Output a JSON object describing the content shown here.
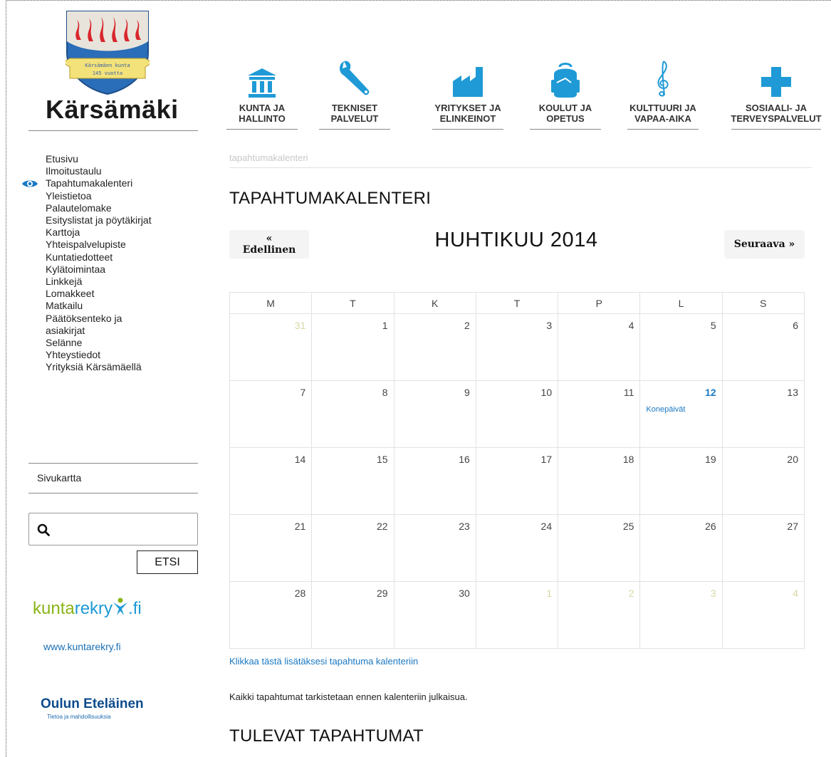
{
  "site": {
    "name": "Kärsämäki",
    "crest_text_1": "Kärsämäen kunta",
    "crest_text_2": "145 vuotta"
  },
  "top_nav": [
    {
      "line1": "KUNTA JA",
      "line2": "HALLINTO",
      "icon": "town-hall-icon"
    },
    {
      "line1": "TEKNISET",
      "line2": "PALVELUT",
      "icon": "wrench-icon"
    },
    {
      "line1": "YRITYKSET JA",
      "line2": "ELINKEINOT",
      "icon": "factory-icon"
    },
    {
      "line1": "KOULUT JA",
      "line2": "OPETUS",
      "icon": "backpack-icon"
    },
    {
      "line1": "KULTTUURI JA",
      "line2": "VAPAA-AIKA",
      "icon": "treble-clef-icon"
    },
    {
      "line1": "SOSIAALI- JA",
      "line2": "TERVEYSPALVELUT",
      "icon": "medical-cross-icon"
    }
  ],
  "side_nav": [
    "Etusivu",
    "Ilmoitustaulu",
    "Tapahtumakalenteri",
    "Yleistietoa",
    "Palautelomake",
    "Esityslistat ja pöytäkirjat",
    "Karttoja",
    "Yhteispalvelupiste",
    "Kuntatiedotteet",
    "Kylätoimintaa",
    "Linkkejä",
    "Lomakkeet",
    "Matkailu",
    "Päätöksenteko ja asiakirjat",
    "Selänne",
    "Yhteystiedot",
    "Yrityksiä Kärsämäellä"
  ],
  "side_nav_active": "Tapahtumakalenteri",
  "sivukartta": "Sivukartta",
  "search": {
    "placeholder": "",
    "button": "ETSI"
  },
  "kuntarekry": {
    "part1": "kunta",
    "part2": "rekry",
    "part3": ".fi",
    "url": "www.kuntarekry.fi"
  },
  "oulun": {
    "name": "Oulun Eteläinen",
    "tagline": "Tietoa ja mahdollisuuksia"
  },
  "breadcrumb": "tapahtumakalenteri",
  "page_title": "TAPAHTUMAKALENTERI",
  "calendar": {
    "prev": "« Edellinen",
    "next": "Seuraava »",
    "month": "HUHTIKUU 2014",
    "weekdays": [
      "M",
      "T",
      "K",
      "T",
      "P",
      "L",
      "S"
    ],
    "weeks": [
      [
        {
          "d": "31",
          "o": true
        },
        {
          "d": "1"
        },
        {
          "d": "2"
        },
        {
          "d": "3"
        },
        {
          "d": "4"
        },
        {
          "d": "5"
        },
        {
          "d": "6"
        }
      ],
      [
        {
          "d": "7"
        },
        {
          "d": "8"
        },
        {
          "d": "9"
        },
        {
          "d": "10"
        },
        {
          "d": "11"
        },
        {
          "d": "12",
          "ev": "Konepäivät"
        },
        {
          "d": "13"
        }
      ],
      [
        {
          "d": "14"
        },
        {
          "d": "15"
        },
        {
          "d": "16"
        },
        {
          "d": "17"
        },
        {
          "d": "18"
        },
        {
          "d": "19"
        },
        {
          "d": "20"
        }
      ],
      [
        {
          "d": "21"
        },
        {
          "d": "22"
        },
        {
          "d": "23"
        },
        {
          "d": "24"
        },
        {
          "d": "25"
        },
        {
          "d": "26"
        },
        {
          "d": "27"
        }
      ],
      [
        {
          "d": "28"
        },
        {
          "d": "29"
        },
        {
          "d": "30"
        },
        {
          "d": "1",
          "o": true
        },
        {
          "d": "2",
          "o": true
        },
        {
          "d": "3",
          "o": true
        },
        {
          "d": "4",
          "o": true
        }
      ]
    ]
  },
  "add_event_link": "Klikkaa tästä lisätäksesi tapahtuma kalenteriin",
  "note": "Kaikki tapahtumat tarkistetaan ennen kalenteriin julkaisua.",
  "upcoming_title": "TULEVAT TAPAHTUMAT",
  "colors": {
    "accent": "#1a78c2",
    "nav_icon": "#1f9ad6",
    "other_month": "#d9d7a4"
  }
}
